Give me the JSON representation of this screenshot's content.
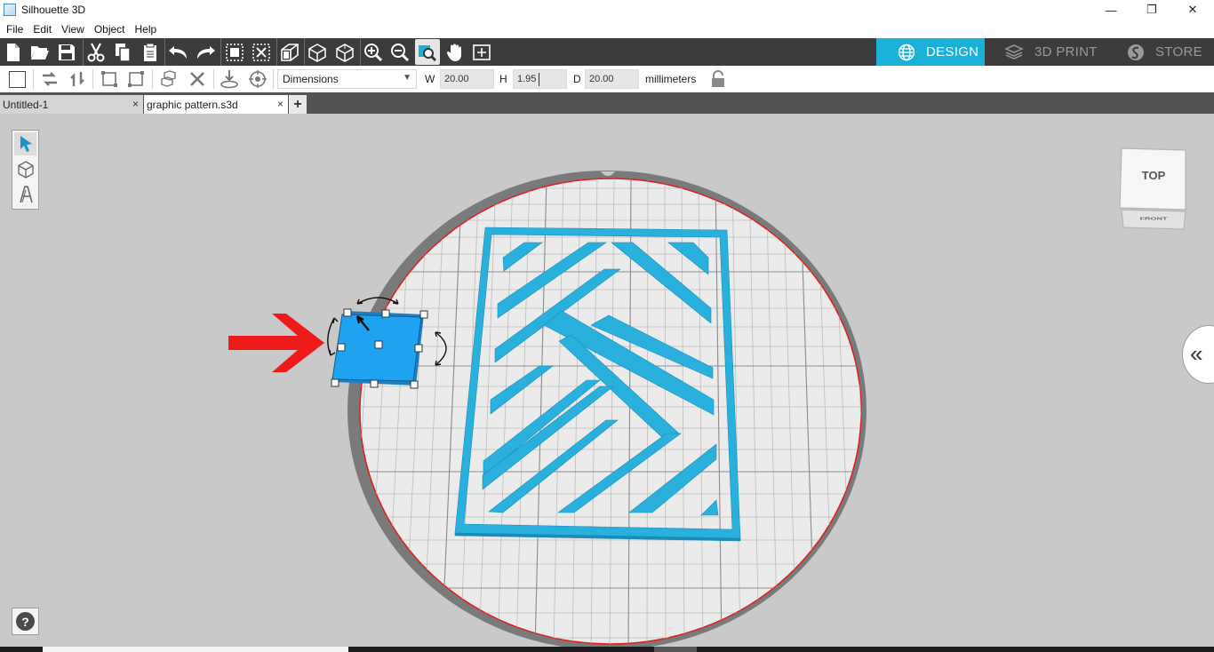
{
  "window": {
    "title": "Silhouette 3D",
    "minimize": "—",
    "maximize": "❐",
    "close": "✕"
  },
  "menu": [
    "File",
    "Edit",
    "View",
    "Object",
    "Help"
  ],
  "modes": {
    "design": "DESIGN",
    "print": "3D PRINT",
    "store": "STORE"
  },
  "dimensions": {
    "mode": "Dimensions",
    "w_label": "W",
    "w_value": "20.00",
    "h_label": "H",
    "h_value": "1.95",
    "d_label": "D",
    "d_value": "20.00",
    "unit": "millimeters"
  },
  "tabs": [
    "Untitled-1",
    "graphic pattern.s3d"
  ],
  "tab_close": "×",
  "tab_add": "+",
  "viewcube": {
    "top": "TOP",
    "front": "FRONT"
  },
  "help": "?",
  "collapse": "«",
  "colors": {
    "accent": "#1ab0d8",
    "object": "#2ab0dd",
    "selected": "#1fa3f0",
    "arrow": "#ee1b1b",
    "toolbar": "#3c3c3c"
  },
  "icons": [
    "new-file-icon",
    "open-folder-icon",
    "save-icon",
    "cut-icon",
    "copy-icon",
    "paste-icon",
    "undo-icon",
    "redo-icon",
    "group-icon",
    "ungroup-icon",
    "extrude-icon",
    "box-icon",
    "box-wire-icon",
    "zoom-in-icon",
    "zoom-out-icon",
    "zoom-fit-icon",
    "pan-hand-icon",
    "grid-icon"
  ]
}
